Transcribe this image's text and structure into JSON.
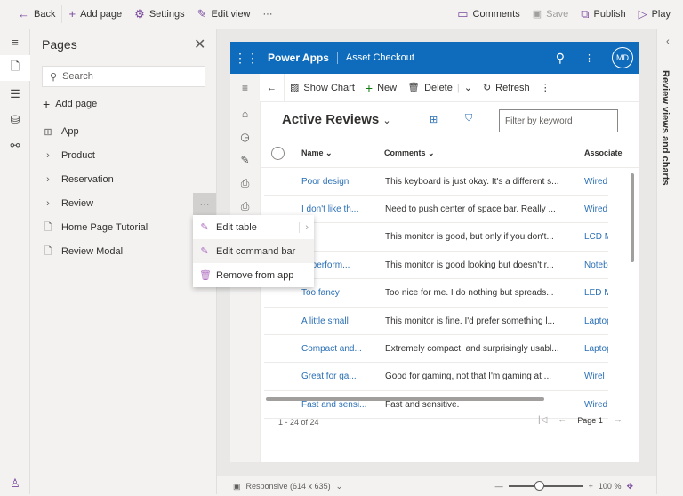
{
  "toolbar": {
    "back": "Back",
    "add_page": "Add page",
    "settings": "Settings",
    "edit_view": "Edit view",
    "more": "···",
    "comments": "Comments",
    "save": "Save",
    "publish": "Publish",
    "play": "Play"
  },
  "pages_panel": {
    "title": "Pages",
    "search_placeholder": "Search",
    "add_page": "Add page",
    "items": [
      {
        "label": "App",
        "icon": "app-grid-icon"
      },
      {
        "label": "Product",
        "icon": "chevron-right-icon"
      },
      {
        "label": "Reservation",
        "icon": "chevron-right-icon"
      },
      {
        "label": "Review",
        "icon": "chevron-right-icon"
      },
      {
        "label": "Home Page Tutorial",
        "icon": "page-icon"
      },
      {
        "label": "Review Modal",
        "icon": "page-icon"
      }
    ]
  },
  "context_menu": {
    "items": [
      "Edit table",
      "Edit command bar",
      "Remove from app"
    ]
  },
  "app": {
    "brand": "Power Apps",
    "app_name": "Asset Checkout",
    "avatar": "MD",
    "accent": "#0f6cbd",
    "commands": {
      "show_chart": "Show Chart",
      "new": "New",
      "delete": "Delete",
      "refresh": "Refresh"
    },
    "view_title": "Active Reviews",
    "filter_placeholder": "Filter by keyword",
    "columns": [
      "Name",
      "Comments",
      "Associate"
    ],
    "rows": [
      [
        "Poor design",
        "This keyboard is just okay. It's a different s...",
        "Wired"
      ],
      [
        "I don't like th...",
        "Need to push center of space bar. Really ...",
        "Wired"
      ],
      [
        "ure",
        "This monitor is good, but only if you don't...",
        "LCD M"
      ],
      [
        "or perform...",
        "This monitor is good looking but doesn't r...",
        "Notebo"
      ],
      [
        "Too fancy",
        "Too nice for me. I do nothing but spreads...",
        "LED M"
      ],
      [
        "A little small",
        "This monitor is fine. I'd prefer something l...",
        "Laptop"
      ],
      [
        "Compact and...",
        "Extremely compact, and surprisingly usabl...",
        "Laptop"
      ],
      [
        "Great for ga...",
        "Good for gaming, not that I'm gaming  at ...",
        "Wirel"
      ],
      [
        "Fast and sensi...",
        "Fast and sensitive.",
        "Wired"
      ]
    ],
    "record_count": "1 - 24 of 24",
    "page": "Page 1"
  },
  "right_panel": {
    "title": "Review views and charts"
  },
  "statusbar": {
    "layout": "Responsive (614 x 635)",
    "zoom": "100 %",
    "zoom_level": 100
  }
}
